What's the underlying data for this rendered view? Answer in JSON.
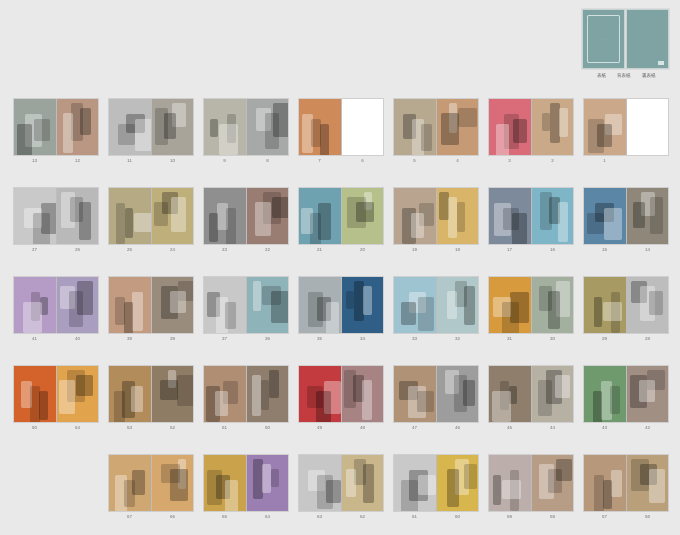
{
  "cover": {
    "labels": [
      "表紙",
      "背表紙",
      "裏表紙"
    ],
    "color": "#7fa2a3"
  },
  "spreads": [
    {
      "left": "13",
      "right": "12",
      "colors": [
        "#9aa39c",
        "#b99782"
      ]
    },
    {
      "left": "11",
      "right": "10",
      "colors": [
        "#bdbdbd",
        "#a8a49a"
      ]
    },
    {
      "left": "9",
      "right": "8",
      "colors": [
        "#b8b6a8",
        "#a7a9a9"
      ]
    },
    {
      "left": "7",
      "right": "6",
      "colors": [
        "#cf8a5a",
        "#ffffff"
      ]
    },
    {
      "left": "5",
      "right": "4",
      "colors": [
        "#b7a890",
        "#c59a74"
      ]
    },
    {
      "left": "3",
      "right": "2",
      "colors": [
        "#d96c78",
        "#c9a987"
      ]
    },
    {
      "left": "1",
      "right": "",
      "colors": [
        "#caa889",
        "#ffffff"
      ]
    },
    {
      "left": "27",
      "right": "26",
      "colors": [
        "#c9c9c9",
        "#b9b9b9"
      ]
    },
    {
      "left": "25",
      "right": "24",
      "colors": [
        "#b5aa84",
        "#bfaf7a"
      ]
    },
    {
      "left": "23",
      "right": "22",
      "colors": [
        "#8f8f8f",
        "#9a7d72"
      ]
    },
    {
      "left": "21",
      "right": "20",
      "colors": [
        "#6fa2b0",
        "#b6c08a"
      ]
    },
    {
      "left": "19",
      "right": "18",
      "colors": [
        "#b9a58f",
        "#d8b569"
      ]
    },
    {
      "left": "17",
      "right": "16",
      "colors": [
        "#7d8a9c",
        "#7fb6c7"
      ]
    },
    {
      "left": "15",
      "right": "14",
      "colors": [
        "#5c86a6",
        "#8f887a"
      ]
    },
    {
      "left": "41",
      "right": "40",
      "colors": [
        "#b59cc6",
        "#a99dc0"
      ]
    },
    {
      "left": "39",
      "right": "38",
      "colors": [
        "#c39b80",
        "#9a8c7c"
      ]
    },
    {
      "left": "37",
      "right": "36",
      "colors": [
        "#c8c8c8",
        "#8eb3b9"
      ]
    },
    {
      "left": "35",
      "right": "34",
      "colors": [
        "#a8b0b3",
        "#2f5f86"
      ]
    },
    {
      "left": "33",
      "right": "32",
      "colors": [
        "#9ec4d1",
        "#b0c8c9"
      ]
    },
    {
      "left": "31",
      "right": "30",
      "colors": [
        "#d79a3c",
        "#a3b09f"
      ]
    },
    {
      "left": "29",
      "right": "28",
      "colors": [
        "#a89a63",
        "#bdbdbd"
      ]
    },
    {
      "left": "50",
      "right": "54",
      "colors": [
        "#d3632a",
        "#e2a34d"
      ]
    },
    {
      "left": "53",
      "right": "52",
      "colors": [
        "#b28c5b",
        "#8f7c64"
      ]
    },
    {
      "left": "51",
      "right": "50",
      "colors": [
        "#b08e74",
        "#8f7e6e"
      ]
    },
    {
      "left": "49",
      "right": "48",
      "colors": [
        "#c33b3e",
        "#a88383"
      ]
    },
    {
      "left": "47",
      "right": "46",
      "colors": [
        "#b09377",
        "#9d9d9d"
      ]
    },
    {
      "left": "45",
      "right": "44",
      "colors": [
        "#8f7e6c",
        "#b7b1a4"
      ]
    },
    {
      "left": "43",
      "right": "42",
      "colors": [
        "#6e9a6e",
        "#a28f84"
      ]
    },
    {
      "left": "67",
      "right": "66",
      "colors": [
        "#cfa772",
        "#d6a86e"
      ]
    },
    {
      "left": "65",
      "right": "64",
      "colors": [
        "#c9a24b",
        "#9b7fb3"
      ]
    },
    {
      "left": "63",
      "right": "62",
      "colors": [
        "#c7c7c7",
        "#c9b68b"
      ]
    },
    {
      "left": "61",
      "right": "60",
      "colors": [
        "#c9c9c9",
        "#d8b64e"
      ]
    },
    {
      "left": "59",
      "right": "58",
      "colors": [
        "#bcaeaa",
        "#b79d86"
      ]
    },
    {
      "left": "57",
      "right": "56",
      "colors": [
        "#b8987a",
        "#b9a07a"
      ]
    }
  ]
}
